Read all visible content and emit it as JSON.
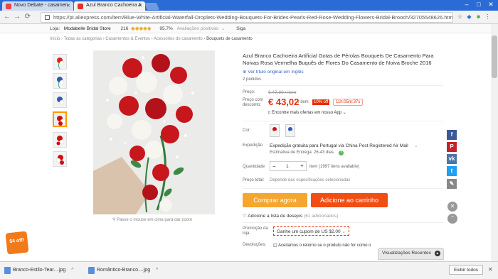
{
  "browser": {
    "tabs": [
      {
        "label": "Novo Debate - casamen"
      },
      {
        "label": "Azul Branco Cachoeira A"
      }
    ],
    "url": "https://pt.aliexpress.com/item/Blue-White-Artificial-Waterfall-Droplets-Wedding-Bouquets-For-Brides-Pearls-Red-Rose-Wedding-Flowers-Bridal-Brooch/32705548626.html"
  },
  "store": {
    "prefix": "Loja:",
    "name": "Modabelle Bridal Store",
    "score": "216",
    "rating": "95.7%",
    "rating_label": "Avaliações positivas",
    "follow": "Siga"
  },
  "breadcrumb": [
    "Início",
    "Todas as categorias",
    "Casamentos & Eventos",
    "Acessórios do casamento",
    "Bouquets de casamento"
  ],
  "product": {
    "title": "Azul Branco Cachoeira Artificial Gotas de Pérolas Bouquets De Casamento Para Noivas Rosa Vermelha Buquês de Flores Do Casamento de Noiva Broche 2016",
    "original_link": "Ver título original em Inglês",
    "orders": "2 pedidos",
    "price_label": "Preço:",
    "old_price": "€ 47,80 / item",
    "discount_label": "Preço com desconto:",
    "price": "€ 43,02",
    "unit": "/ item",
    "off_badge": "10% off",
    "timer": "11h:05m:37s",
    "app_offer": "Encontre mais ofertas em nosso App",
    "color_label": "Cor:",
    "shipping_label": "Expedição",
    "shipping_text": "Expedição gratuita para Portugal via China Post Registered Air Mail",
    "delivery": "Estimativa de Entrega: 26-43 dias",
    "qty_label": "Quantidade",
    "qty_value": "1",
    "qty_available": "item (1997 itens available)",
    "total_label": "Preço total:",
    "total_text": "Depende das especificações selecionadas",
    "buy_now": "Comprar agora",
    "add_cart": "Adicione ao carrinho",
    "wishlist": "Adicione a lista de desejos",
    "wishlist_count": "(61 adicionados)",
    "store_promo_label": "Promoção da loja:",
    "coupon": "Ganhe um cupom de US $2.00",
    "returns_label": "Devoluções:",
    "returns_text": "Aceitamos o retorno se o produto não for como o",
    "zoom_hint": "Passe o mouse em cima para dar zoom"
  },
  "promo_sticker": "$4 off!",
  "recent_views": "Visualizações Recentes",
  "downloads": [
    {
      "name": "Branco-Estilo-Tear....jpg"
    },
    {
      "name": "Romântico-Branco....jpg"
    }
  ],
  "show_all": "Exibir todos",
  "colors": {
    "accent": "#f27a1a",
    "price": "#e62e04",
    "chrome_tabbar": "#2b6bd6"
  }
}
